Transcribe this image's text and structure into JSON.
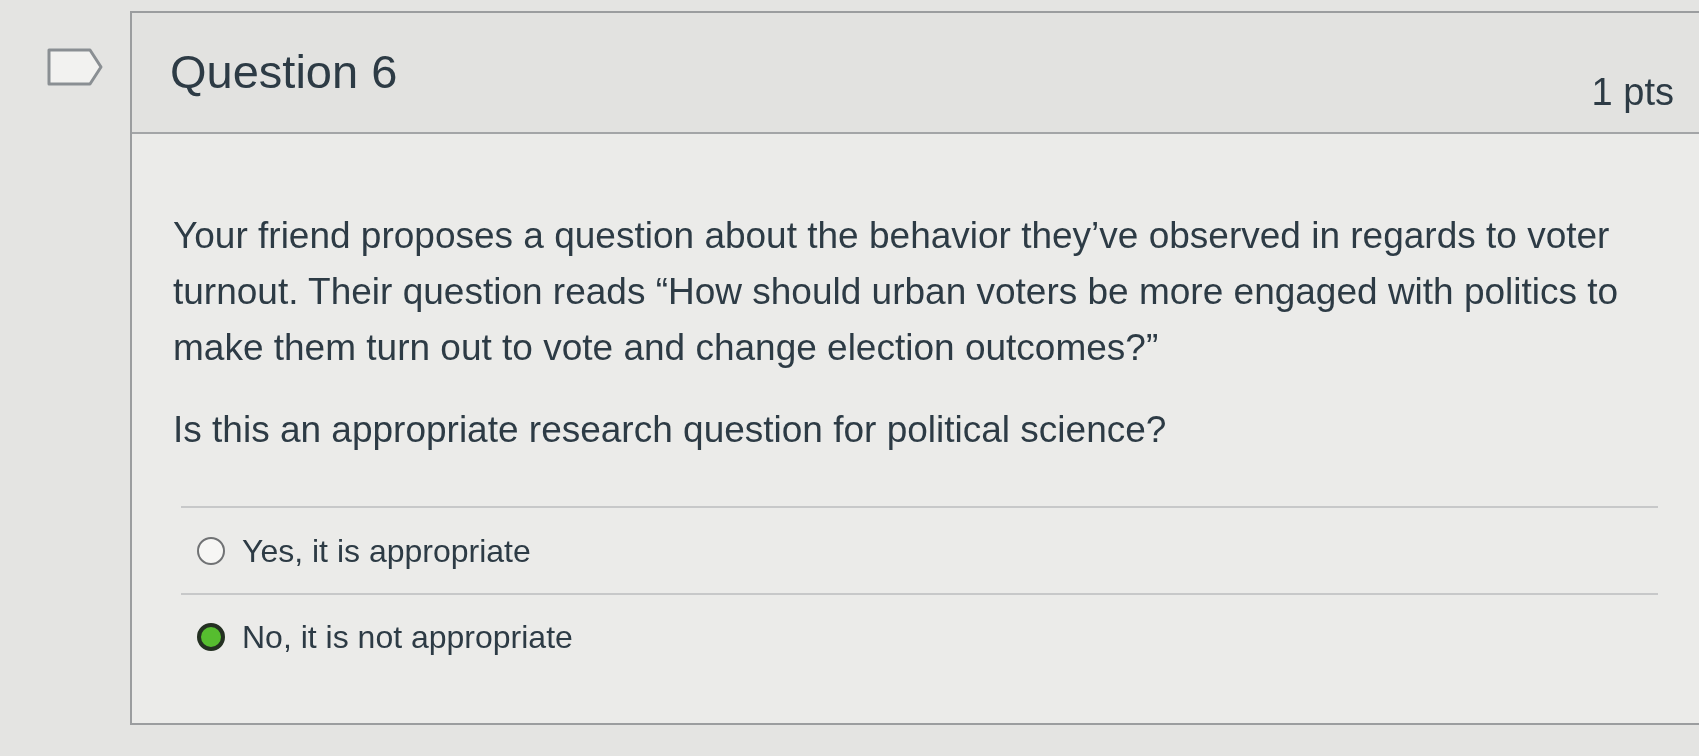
{
  "question": {
    "flagged": false,
    "title": "Question 6",
    "points": "1 pts"
  },
  "body": {
    "prompt": "Your friend proposes a question about the behavior they’ve observed in regards to voter turnout. Their question reads “How should urban voters be more engaged with politics to make them turn out to vote and change election outcomes?”",
    "question": "Is this an appropriate research question for political science?"
  },
  "answers": [
    {
      "label": "Yes, it is appropriate",
      "selected": false
    },
    {
      "label": "No, it is not appropriate",
      "selected": true
    }
  ]
}
